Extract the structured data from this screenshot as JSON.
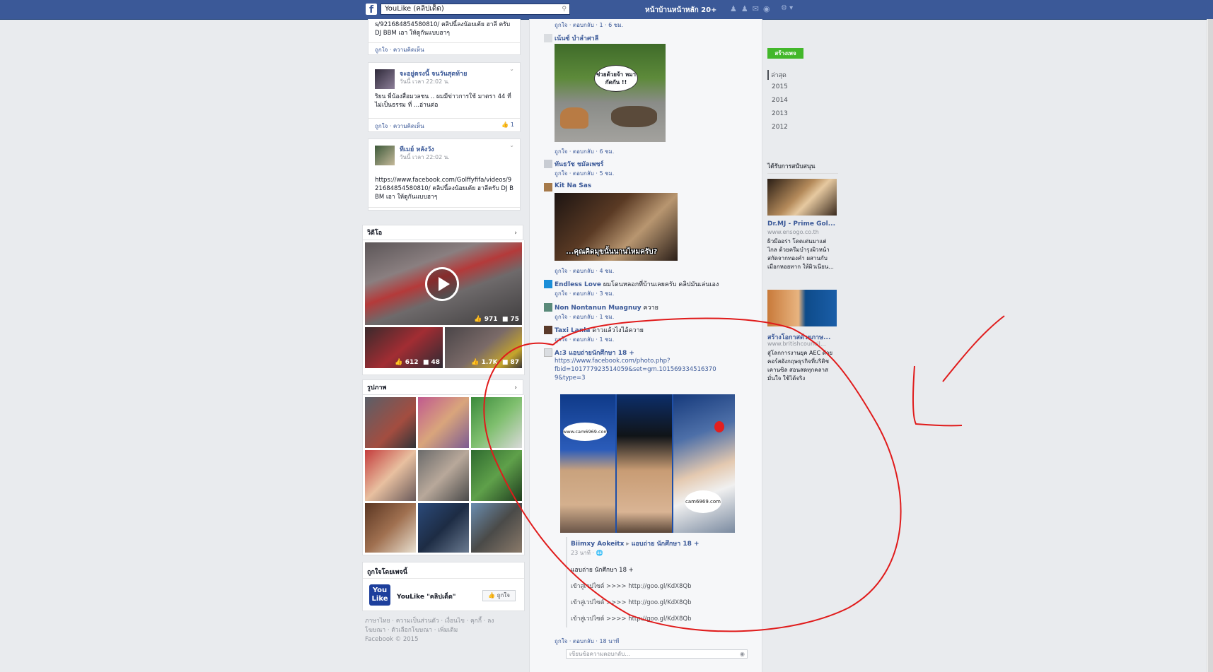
{
  "topbar": {
    "logo": "f",
    "search_value": "YouLike (คลิปเด็ด)",
    "profile_name": "หน้าบ้านหน้าหลัก 20+",
    "nav_icons": [
      "friends-icon",
      "messages-icon",
      "globe-icon"
    ]
  },
  "left": {
    "post1": {
      "text": "s/921684854580810/ คลิปนี้ลงน้อยเค้ย ฮาลี ครับ DJ BBM เอา ให้ดูกันแบบฮาๆ",
      "actions": "ถูกใจ · ความคิดเห็น"
    },
    "post2": {
      "name": "จะอยู่ตรงนี้ จนวันสุดท้าย",
      "time": "วันนี้ เวลา 22:02 น.",
      "text": "ริยน พี่น้องสื่อมวลชน .. ผมมีข่าวการใช้ มาตรา 44 ที่ไม่เป็นธรรม ที่ ...อ่านต่อ",
      "actions": "ถูกใจ · ความคิดเห็น",
      "likes": "1"
    },
    "post3": {
      "name": "ทีเมย์ หลังวัง",
      "time": "วันนี้ เวลา 22:02 น.",
      "text": "https://www.facebook.com/Golffyfifa/videos/921684854580810/ คลิปนี้ลงน้อยเค้ย ฮาลีครับ DJ BBM เอา ให้ดูกันแบบฮาๆ",
      "actions": "ถูกใจ · ความคิดเห็น"
    },
    "videos": {
      "title": "วิดีโอ",
      "main_likes": "971",
      "main_comments": "75",
      "v2_likes": "612",
      "v2_comments": "48",
      "v3_likes": "1.7K",
      "v3_comments": "87"
    },
    "photos": {
      "title": "รูปภาพ"
    },
    "liked_pages": {
      "title": "ถูกใจโดยเพจนี้",
      "page_name": "YouLike \"คลิปเด็ด\"",
      "like_button": "ถูกใจ"
    },
    "footer": {
      "line1": "ภาษาไทย · ความเป็นส่วนตัว · เงื่อนไข · คุกกี้ · ลง",
      "line2": "โฆษณา · ตัวเลือกโฆษณา · เพิ่มเติม",
      "line3": "Facebook © 2015"
    }
  },
  "main": {
    "top_actions": "ถูกใจ · ตอบกลับ · 1 · 6 ชม.",
    "c1": {
      "name": "เน้นซ์ บำลำศาลี",
      "bubble": "ช่วยด้วยจ้า หมากัดกัน !!",
      "actions": "ถูกใจ · ตอบกลับ · 6 ชม."
    },
    "c2": {
      "name": "ทันธวัช ชมัลเพชร์",
      "actions": "ถูกใจ · ตอบกลับ · 5 ชม."
    },
    "c3": {
      "name": "Kit Na Sas",
      "caption": "...คุณคิดมุขนั้นนานไหมครับ?",
      "actions": "ถูกใจ · ตอบกลับ · 4 ชม."
    },
    "c4": {
      "name": "Endless Love",
      "text": "ผมโดนหลอกที่บ้านเลยครับ คลิปมันเล่นเอง",
      "actions": "ถูกใจ · ตอบกลับ · 3 ชม."
    },
    "c5": {
      "name": "Non Nontanun Muagnuy",
      "text": "ควาย",
      "actions": "ถูกใจ · ตอบกลับ · 1 ชม."
    },
    "c6": {
      "name": "Taxi Lanla",
      "text": "ดาวแล้วไงไอ้ควาย",
      "actions": "ถูกใจ · ตอบกลับ · 1 ชม."
    },
    "c7": {
      "name": "A:3 แอบถ่ายนักศึกษา 18 +",
      "url1": "https://www.facebook.com/photo.php?",
      "url2": "fbid=101777923514059&set=gm.101569334516370",
      "url3": "9&type=3",
      "watermark1": "www.cam6969.com",
      "watermark2": "cam6969.com",
      "share_author": "Biimxy Aokeitx",
      "share_target": "แอบถ่าย นักศึกษา 18 +",
      "share_time": "23 นาที",
      "share_title": "แอบถ่าย นักศึกษา 18 +",
      "share_link1": "เข้าสู่เวปไซต์ >>>> http://goo.gl/KdX8Qb",
      "share_link2": "เข้าสู่เวปไซต์ >>>> http://goo.gl/KdX8Qb",
      "share_link3": "เข้าสู่เวปไซต์ >>>> http://goo.gl/KdX8Qb",
      "actions": "ถูกใจ · ตอบกลับ · 18 นาที"
    },
    "reply_placeholder": "เขียนข้อความตอบกลับ..."
  },
  "right": {
    "create_page": "สร้างเพจ",
    "years": [
      "ล่าสุด",
      "2015",
      "2014",
      "2013",
      "2012"
    ],
    "sponsored": "ได้รับการสนับสนุน",
    "ad1": {
      "title": "Dr.MJ - Prime Gol...",
      "url": "www.ensogo.co.th",
      "body": "ผิวมีออร่า โดดเด่นมาแต่ไกล ด้วยครีมบำรุงผิวหน้าสกัดจากทองคำ ผสานกับเมือกหอยทาก ให้ผิวเนียน..."
    },
    "ad2": {
      "title": "สร้างโอกาสด้วยภาษ...",
      "url": "www.britishcouncil...",
      "body": "สู่โลกการงานยุค AEC ด้วยคอร์สอังกฤษธุรกิจที่บริติช เคานซิล สอนสดทุกคลาส มั่นใจ ใช้ได้จริง"
    }
  },
  "colors": {
    "fb_blue": "#3b5998",
    "annotation_red": "#e01b1b",
    "create_green": "#42b72a"
  }
}
